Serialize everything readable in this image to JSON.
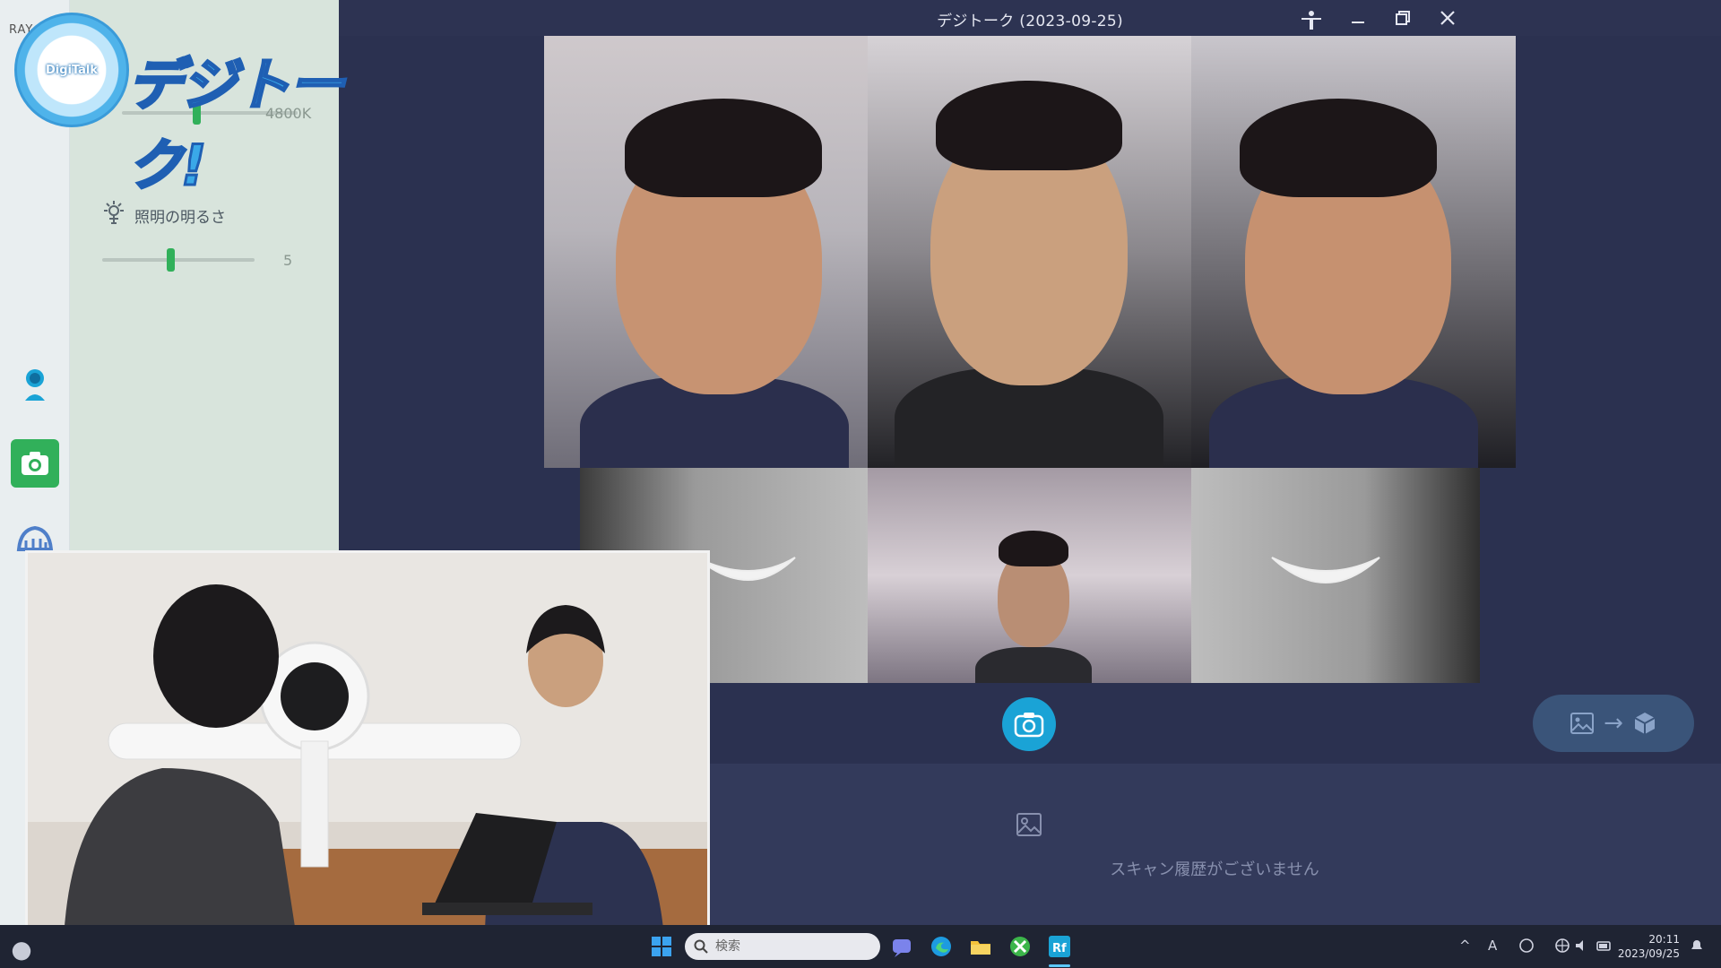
{
  "app": {
    "title": "デジトーク (2023-09-25)",
    "rail_text": "RAY",
    "logo_badge": "DigiTalk",
    "logo_text": "デジトーク!"
  },
  "settings": {
    "color_temp_value": "4800K",
    "color_temp_level": 0.42,
    "brightness_label": "照明の明るさ",
    "brightness_value": "5",
    "brightness_level": 0.45
  },
  "history": {
    "empty_text": "スキャン履歴がございません"
  },
  "taskbar": {
    "search_placeholder": "検索",
    "time": "20:11",
    "date": "2023/09/25",
    "ime": "A"
  },
  "colors": {
    "accent_green": "#31b05a",
    "capture_blue": "#1aa3d6",
    "bg_navy": "#2b3150"
  }
}
